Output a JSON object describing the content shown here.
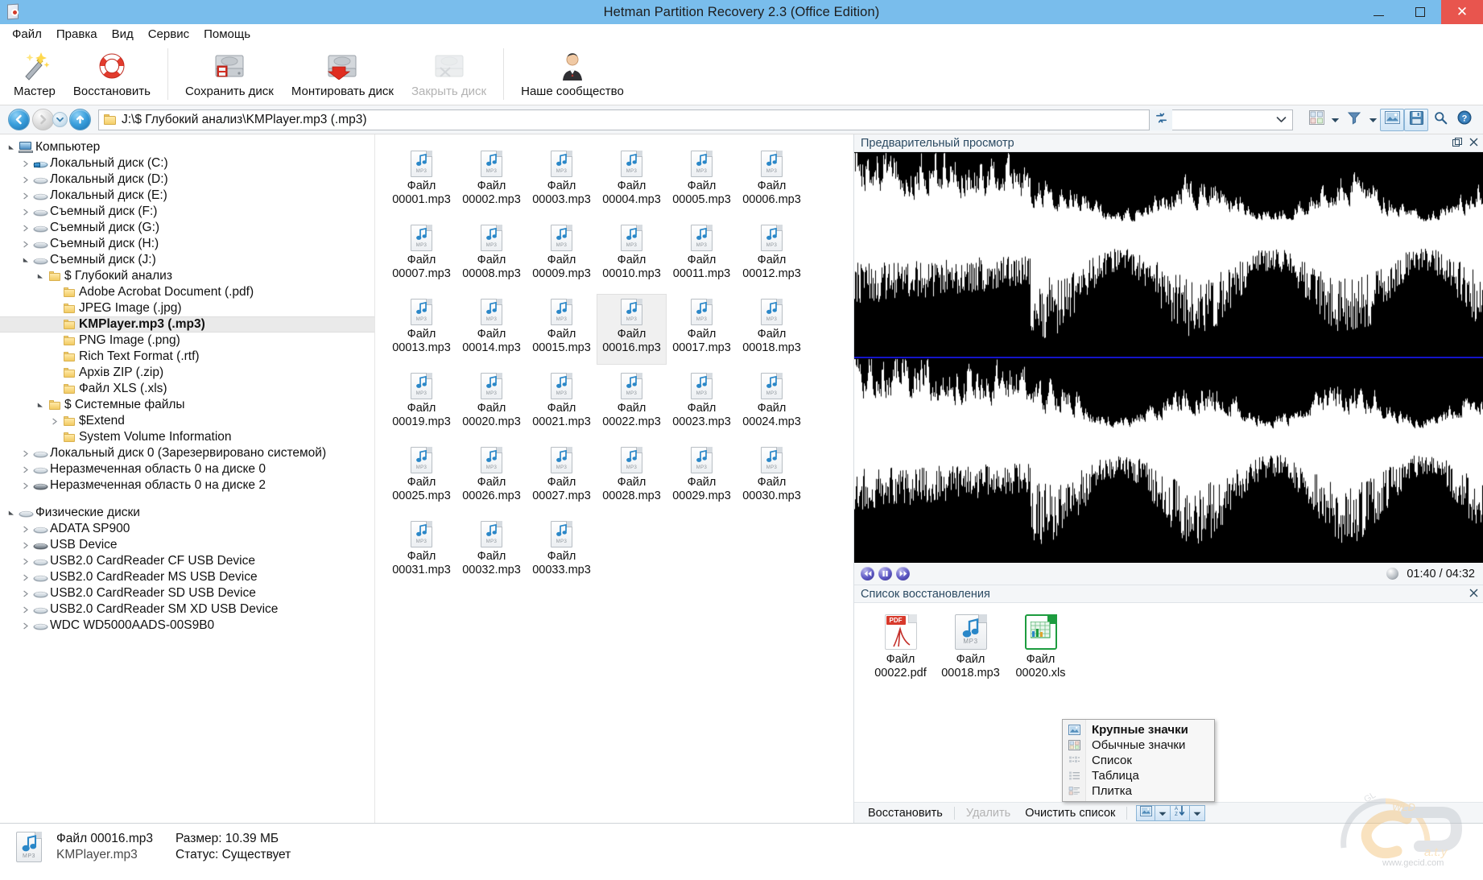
{
  "window": {
    "title": "Hetman Partition Recovery 2.3 (Office Edition)",
    "minimize_label": "–",
    "maximize_label": "❐",
    "close_label": "✕",
    "app_icon": "hetman-app-icon"
  },
  "menubar": {
    "items": [
      {
        "label": "Файл"
      },
      {
        "label": "Правка"
      },
      {
        "label": "Вид"
      },
      {
        "label": "Сервис"
      },
      {
        "label": "Помощь"
      }
    ]
  },
  "ribbon": {
    "buttons": [
      {
        "label": "Мастер",
        "icon": "magic-wand-icon",
        "enabled": true
      },
      {
        "label": "Восстановить",
        "icon": "lifebuoy-icon",
        "enabled": true
      },
      {
        "label": "Сохранить диск",
        "icon": "save-disk-icon",
        "enabled": true
      },
      {
        "label": "Монтировать диск",
        "icon": "mount-disk-icon",
        "enabled": true
      },
      {
        "label": "Закрыть диск",
        "icon": "close-disk-icon",
        "enabled": false
      },
      {
        "label": "Наше сообщество",
        "icon": "community-person-icon",
        "enabled": true
      }
    ]
  },
  "addressbar": {
    "back_icon": "back-arrow-icon",
    "forward_icon": "forward-arrow-icon",
    "history_icon": "history-dropdown-icon",
    "up_icon": "up-arrow-icon",
    "path": "J:\\$ Глубокий анализ\\KMPlayer.mp3 (.mp3)",
    "refresh_icon": "refresh-icon",
    "filter_combo_value": "",
    "right_tools": [
      {
        "icon": "view-mode-icon",
        "name": "view-mode-button"
      },
      {
        "icon": "chevron-down-icon",
        "name": "view-mode-caret"
      },
      {
        "icon": "filter-funnel-icon",
        "name": "filter-button"
      },
      {
        "icon": "chevron-down-icon",
        "name": "filter-caret"
      },
      {
        "icon": "preview-pane-icon",
        "name": "preview-pane-toggle"
      },
      {
        "icon": "floppy-save-icon",
        "name": "recovery-list-toggle"
      },
      {
        "icon": "search-icon",
        "name": "search-button"
      },
      {
        "icon": "help-icon",
        "name": "help-button"
      }
    ]
  },
  "tree": {
    "nodes": [
      {
        "label": "Компьютер",
        "indent": 0,
        "arrow": "open",
        "icon": "computer-icon"
      },
      {
        "label": "Локальный диск (C:)",
        "indent": 1,
        "arrow": "closed",
        "icon": "system-disk-icon"
      },
      {
        "label": "Локальный диск (D:)",
        "indent": 1,
        "arrow": "closed",
        "icon": "disk-icon"
      },
      {
        "label": "Локальный диск (E:)",
        "indent": 1,
        "arrow": "closed",
        "icon": "disk-icon"
      },
      {
        "label": "Съемный диск (F:)",
        "indent": 1,
        "arrow": "closed",
        "icon": "removable-disk-icon"
      },
      {
        "label": "Съемный диск (G:)",
        "indent": 1,
        "arrow": "closed",
        "icon": "removable-disk-icon"
      },
      {
        "label": "Съемный диск (H:)",
        "indent": 1,
        "arrow": "closed",
        "icon": "removable-disk-icon"
      },
      {
        "label": "Съемный диск (J:)",
        "indent": 1,
        "arrow": "open",
        "icon": "removable-disk-icon"
      },
      {
        "label": "$ Глубокий анализ",
        "indent": 2,
        "arrow": "open",
        "icon": "folder-icon"
      },
      {
        "label": "Adobe Acrobat Document (.pdf)",
        "indent": 3,
        "arrow": "none",
        "icon": "folder-icon"
      },
      {
        "label": "JPEG Image (.jpg)",
        "indent": 3,
        "arrow": "none",
        "icon": "folder-icon"
      },
      {
        "label": "KMPlayer.mp3 (.mp3)",
        "indent": 3,
        "arrow": "none",
        "icon": "folder-icon",
        "selected": true
      },
      {
        "label": "PNG Image (.png)",
        "indent": 3,
        "arrow": "none",
        "icon": "folder-icon"
      },
      {
        "label": "Rich Text Format (.rtf)",
        "indent": 3,
        "arrow": "none",
        "icon": "folder-icon"
      },
      {
        "label": "Архів ZIP (.zip)",
        "indent": 3,
        "arrow": "none",
        "icon": "folder-icon"
      },
      {
        "label": "Файл XLS (.xls)",
        "indent": 3,
        "arrow": "none",
        "icon": "folder-icon"
      },
      {
        "label": "$ Системные файлы",
        "indent": 2,
        "arrow": "open",
        "icon": "folder-icon"
      },
      {
        "label": "$Extend",
        "indent": 3,
        "arrow": "closed",
        "icon": "folder-icon"
      },
      {
        "label": "System Volume Information",
        "indent": 3,
        "arrow": "none",
        "icon": "folder-icon"
      },
      {
        "label": "Локальный диск 0 (Зарезервировано системой)",
        "indent": 1,
        "arrow": "closed",
        "icon": "disk-icon"
      },
      {
        "label": "Неразмеченная область 0 на диске 0",
        "indent": 1,
        "arrow": "closed",
        "icon": "disk-icon"
      },
      {
        "label": "Неразмеченная область 0 на диске 2",
        "indent": 1,
        "arrow": "closed",
        "icon": "disk-dark-icon"
      },
      {
        "gap": true
      },
      {
        "label": "Физические диски",
        "indent": 0,
        "arrow": "open",
        "icon": "disk-icon"
      },
      {
        "label": "ADATA SP900",
        "indent": 1,
        "arrow": "closed",
        "icon": "disk-icon"
      },
      {
        "label": "USB Device",
        "indent": 1,
        "arrow": "closed",
        "icon": "disk-dark-icon"
      },
      {
        "label": "USB2.0 CardReader CF USB Device",
        "indent": 1,
        "arrow": "closed",
        "icon": "disk-icon"
      },
      {
        "label": "USB2.0 CardReader MS USB Device",
        "indent": 1,
        "arrow": "closed",
        "icon": "disk-icon"
      },
      {
        "label": "USB2.0 CardReader SD USB Device",
        "indent": 1,
        "arrow": "closed",
        "icon": "disk-icon"
      },
      {
        "label": "USB2.0 CardReader SM XD USB Device",
        "indent": 1,
        "arrow": "closed",
        "icon": "disk-icon"
      },
      {
        "label": "WDC WD5000AADS-00S9B0",
        "indent": 1,
        "arrow": "closed",
        "icon": "disk-icon"
      }
    ]
  },
  "filegrid": {
    "files": [
      {
        "line1": "Файл",
        "line2": "00001.mp3"
      },
      {
        "line1": "Файл",
        "line2": "00002.mp3"
      },
      {
        "line1": "Файл",
        "line2": "00003.mp3"
      },
      {
        "line1": "Файл",
        "line2": "00004.mp3"
      },
      {
        "line1": "Файл",
        "line2": "00005.mp3"
      },
      {
        "line1": "Файл",
        "line2": "00006.mp3"
      },
      {
        "line1": "Файл",
        "line2": "00007.mp3"
      },
      {
        "line1": "Файл",
        "line2": "00008.mp3"
      },
      {
        "line1": "Файл",
        "line2": "00009.mp3"
      },
      {
        "line1": "Файл",
        "line2": "00010.mp3"
      },
      {
        "line1": "Файл",
        "line2": "00011.mp3"
      },
      {
        "line1": "Файл",
        "line2": "00012.mp3"
      },
      {
        "line1": "Файл",
        "line2": "00013.mp3"
      },
      {
        "line1": "Файл",
        "line2": "00014.mp3"
      },
      {
        "line1": "Файл",
        "line2": "00015.mp3"
      },
      {
        "line1": "Файл",
        "line2": "00016.mp3",
        "selected": true
      },
      {
        "line1": "Файл",
        "line2": "00017.mp3"
      },
      {
        "line1": "Файл",
        "line2": "00018.mp3"
      },
      {
        "line1": "Файл",
        "line2": "00019.mp3"
      },
      {
        "line1": "Файл",
        "line2": "00020.mp3"
      },
      {
        "line1": "Файл",
        "line2": "00021.mp3"
      },
      {
        "line1": "Файл",
        "line2": "00022.mp3"
      },
      {
        "line1": "Файл",
        "line2": "00023.mp3"
      },
      {
        "line1": "Файл",
        "line2": "00024.mp3"
      },
      {
        "line1": "Файл",
        "line2": "00025.mp3"
      },
      {
        "line1": "Файл",
        "line2": "00026.mp3"
      },
      {
        "line1": "Файл",
        "line2": "00027.mp3"
      },
      {
        "line1": "Файл",
        "line2": "00028.mp3"
      },
      {
        "line1": "Файл",
        "line2": "00029.mp3"
      },
      {
        "line1": "Файл",
        "line2": "00030.mp3"
      },
      {
        "line1": "Файл",
        "line2": "00031.mp3"
      },
      {
        "line1": "Файл",
        "line2": "00032.mp3"
      },
      {
        "line1": "Файл",
        "line2": "00033.mp3"
      }
    ],
    "icon_tag": "MP3"
  },
  "preview": {
    "title": "Предварительный просмотр",
    "undock_icon": "undock-icon",
    "close_icon": "close-icon",
    "player": {
      "rewind_icon": "rewind-icon",
      "pause_icon": "pause-icon",
      "forward_icon": "fast-forward-icon",
      "volume_icon": "volume-knob-icon",
      "time": "01:40 / 04:32",
      "elapsed": "01:40",
      "duration": "04:32"
    }
  },
  "recovery_list": {
    "title": "Список восстановления",
    "close_icon": "close-icon",
    "files": [
      {
        "line1": "Файл",
        "line2": "00022.pdf",
        "icon": "pdf-file-icon",
        "badge": "PDF"
      },
      {
        "line1": "Файл",
        "line2": "00018.mp3",
        "icon": "mp3-file-icon",
        "badge": "MP3"
      },
      {
        "line1": "Файл",
        "line2": "00020.xls",
        "icon": "xls-file-icon",
        "badge": ""
      }
    ],
    "toolbar": {
      "restore_label": "Восстановить",
      "delete_label": "Удалить",
      "delete_enabled": false,
      "clear_label": "Очистить список",
      "view_icon": "large-icons-icon",
      "view_caret_icon": "chevron-down-icon",
      "sort_icon": "sort-az-icon",
      "sort_caret_icon": "chevron-down-icon"
    }
  },
  "context_menu": {
    "items": [
      {
        "label": "Крупные значки",
        "icon": "large-icons-icon",
        "selected": true
      },
      {
        "label": "Обычные значки",
        "icon": "normal-icons-icon",
        "selected": false
      },
      {
        "label": "Список",
        "icon": "list-view-icon",
        "selected": false
      },
      {
        "label": "Таблица",
        "icon": "table-view-icon",
        "selected": false
      },
      {
        "label": "Плитка",
        "icon": "tiles-view-icon",
        "selected": false
      }
    ]
  },
  "statusbar": {
    "file_icon": "mp3-file-icon",
    "file_name": "Файл 00016.mp3",
    "parent": "KMPlayer.mp3",
    "size_label": "Размер: 10.39 МБ",
    "status_label": "Статус: Существует"
  },
  "watermark": {
    "brand": "GECID.com",
    "sub": "www.gecid.com",
    "top": "GLOBAL"
  },
  "colors": {
    "titlebar": "#79bdec",
    "close_button": "#e8554e",
    "selection": "#eaeaea",
    "accent": "#2b6ca3",
    "waveform_bg": "#000000",
    "waveform_fg": "#ffffff",
    "channel_separator": "#1414c8"
  }
}
